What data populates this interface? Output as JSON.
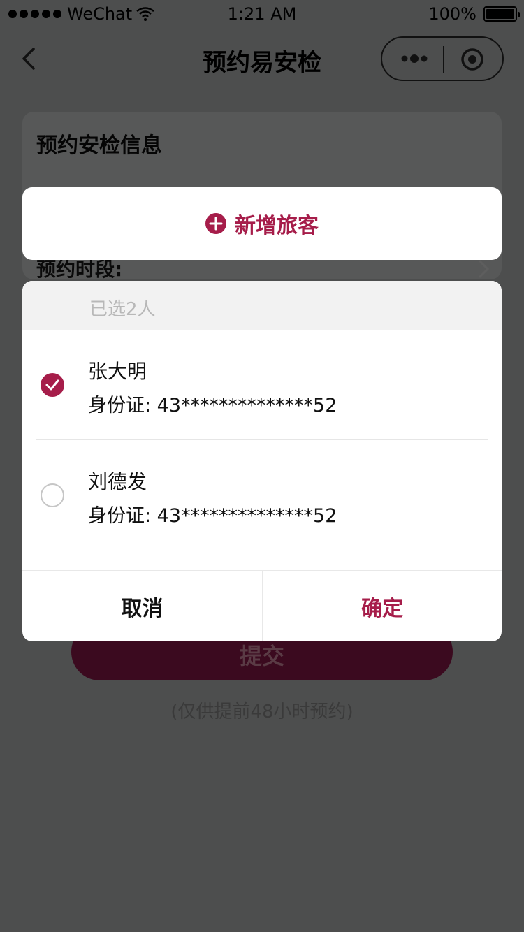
{
  "status_bar": {
    "carrier": "WeChat",
    "time": "1:21 AM",
    "battery": "100%"
  },
  "nav": {
    "title": "预约易安检"
  },
  "background": {
    "card_title": "预约安检信息",
    "time_slot_label": "预约时段:",
    "submit_label": "提交",
    "note": "(仅供提前48小时预约)"
  },
  "add_traveler": {
    "label": "新增旅客"
  },
  "selector": {
    "selected_count": "已选2人",
    "travelers": [
      {
        "name": "张大明",
        "id": "身份证: 43**************52",
        "checked": true
      },
      {
        "name": "刘德发",
        "id": "身份证: 43**************52",
        "checked": false
      }
    ],
    "cancel_label": "取消",
    "confirm_label": "确定"
  },
  "colors": {
    "accent": "#a61d4a",
    "overlay": "#4d4e4e"
  }
}
